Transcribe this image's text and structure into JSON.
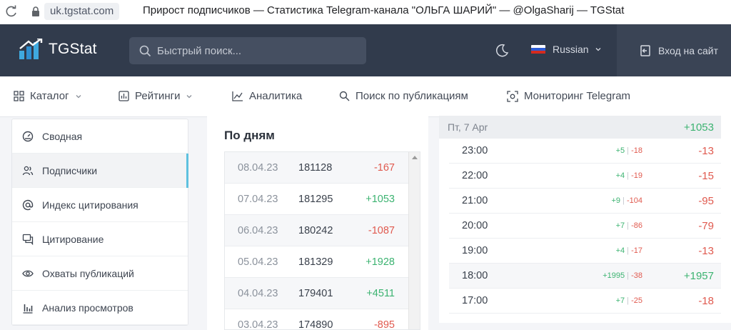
{
  "browser": {
    "url": "uk.tgstat.com",
    "title": "Прирост подписчиков — Статистика Telegram-канала \"ОЛЬГА ШАРИЙ\" — @OlgaSharij — TGStat"
  },
  "header": {
    "logo": "TGStat",
    "search_placeholder": "Быстрый поиск...",
    "language": "Russian",
    "login": "Вход на сайт"
  },
  "nav": [
    {
      "label": "Каталог",
      "icon": "grid-icon",
      "has_dropdown": true
    },
    {
      "label": "Рейтинги",
      "icon": "chart-box-icon",
      "has_dropdown": true
    },
    {
      "label": "Аналитика",
      "icon": "line-chart-icon",
      "has_dropdown": false
    },
    {
      "label": "Поиск по публикациям",
      "icon": "search-icon",
      "has_dropdown": false
    },
    {
      "label": "Мониторинг Telegram",
      "icon": "target-icon",
      "has_dropdown": false
    }
  ],
  "sidebar": [
    {
      "label": "Сводная",
      "icon": "dashboard-icon",
      "active": false
    },
    {
      "label": "Подписчики",
      "icon": "users-icon",
      "active": true
    },
    {
      "label": "Индекс цитирования",
      "icon": "at-icon",
      "active": false
    },
    {
      "label": "Цитирование",
      "icon": "quote-icon",
      "active": false
    },
    {
      "label": "Охваты публикаций",
      "icon": "eye-icon",
      "active": false
    },
    {
      "label": "Анализ просмотров",
      "icon": "bar-chart-icon",
      "active": false
    }
  ],
  "by_day": {
    "title": "По дням",
    "rows": [
      {
        "date": "08.04.23",
        "total": "181128",
        "delta": "-167",
        "sign": "neg"
      },
      {
        "date": "07.04.23",
        "total": "181295",
        "delta": "+1053",
        "sign": "pos"
      },
      {
        "date": "06.04.23",
        "total": "180242",
        "delta": "-1087",
        "sign": "neg"
      },
      {
        "date": "05.04.23",
        "total": "181329",
        "delta": "+1928",
        "sign": "pos"
      },
      {
        "date": "04.04.23",
        "total": "179401",
        "delta": "+4511",
        "sign": "pos"
      },
      {
        "date": "03.04.23",
        "total": "174890",
        "delta": "-895",
        "sign": "neg"
      }
    ]
  },
  "by_hour": {
    "day_label": "Пт, 7 Apr",
    "day_total": "+1053",
    "rows": [
      {
        "time": "23:00",
        "in": "+5",
        "out": "-18",
        "net": "-13",
        "sign": "neg"
      },
      {
        "time": "22:00",
        "in": "+4",
        "out": "-19",
        "net": "-15",
        "sign": "neg"
      },
      {
        "time": "21:00",
        "in": "+9",
        "out": "-104",
        "net": "-95",
        "sign": "neg"
      },
      {
        "time": "20:00",
        "in": "+7",
        "out": "-86",
        "net": "-79",
        "sign": "neg"
      },
      {
        "time": "19:00",
        "in": "+4",
        "out": "-17",
        "net": "-13",
        "sign": "neg"
      },
      {
        "time": "18:00",
        "in": "+1995",
        "out": "-38",
        "net": "+1957",
        "sign": "pos"
      },
      {
        "time": "17:00",
        "in": "+7",
        "out": "-25",
        "net": "-18",
        "sign": "neg"
      }
    ]
  },
  "colors": {
    "header_bg": "#313b4c",
    "positive": "#3cb371",
    "negative": "#e05a4f",
    "active_accent": "#5ec1df"
  }
}
